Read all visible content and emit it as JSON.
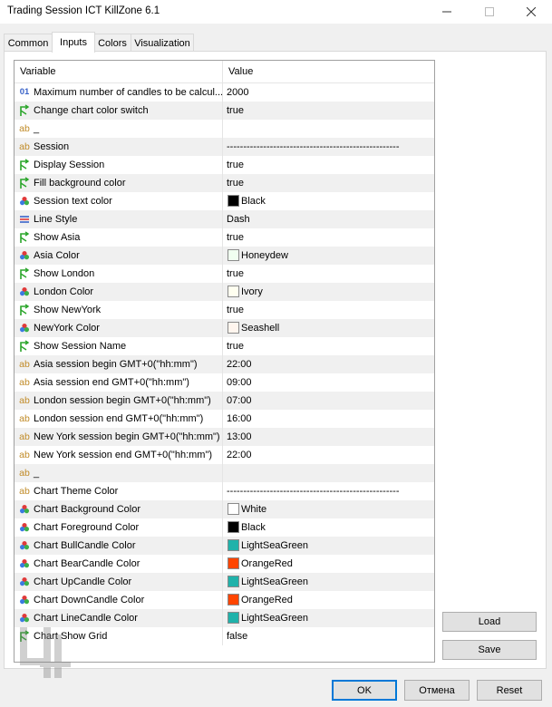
{
  "window": {
    "title": "Trading Session ICT KillZone 6.1",
    "minimize_icon": "minimize-icon",
    "maximize_icon": "maximize-icon",
    "close_icon": "close-icon"
  },
  "tabs": [
    {
      "label": "Common",
      "active": false
    },
    {
      "label": "Inputs",
      "active": true
    },
    {
      "label": "Colors",
      "active": false
    },
    {
      "label": "Visualization",
      "active": false
    }
  ],
  "grid": {
    "headers": {
      "variable": "Variable",
      "value": "Value"
    },
    "rows": [
      {
        "icon": "int",
        "variable": "Maximum number of candles to be calcul...",
        "value": "2000"
      },
      {
        "icon": "bool",
        "variable": "Change chart color switch",
        "value": "true"
      },
      {
        "icon": "string",
        "variable": "_",
        "value": ""
      },
      {
        "icon": "string",
        "variable": "Session",
        "value": "----------------------------------------------------"
      },
      {
        "icon": "bool",
        "variable": "Display Session",
        "value": "true"
      },
      {
        "icon": "bool",
        "variable": "Fill background color",
        "value": "true"
      },
      {
        "icon": "color",
        "variable": "Session text color",
        "value": "Black",
        "swatch": "#000000"
      },
      {
        "icon": "linestyle",
        "variable": "Line Style",
        "value": "Dash"
      },
      {
        "icon": "bool",
        "variable": "Show Asia",
        "value": "true"
      },
      {
        "icon": "color",
        "variable": "Asia Color",
        "value": "Honeydew",
        "swatch": "#f0fff0"
      },
      {
        "icon": "bool",
        "variable": "Show London",
        "value": "true"
      },
      {
        "icon": "color",
        "variable": "London Color",
        "value": "Ivory",
        "swatch": "#fffff0"
      },
      {
        "icon": "bool",
        "variable": "Show NewYork",
        "value": "true"
      },
      {
        "icon": "color",
        "variable": "NewYork Color",
        "value": "Seashell",
        "swatch": "#fff5ee"
      },
      {
        "icon": "bool",
        "variable": "Show Session Name",
        "value": "true"
      },
      {
        "icon": "string",
        "variable": "Asia session begin GMT+0(\"hh:mm\")",
        "value": "22:00"
      },
      {
        "icon": "string",
        "variable": "Asia session end GMT+0(\"hh:mm\")",
        "value": "09:00"
      },
      {
        "icon": "string",
        "variable": "London session begin GMT+0(\"hh:mm\")",
        "value": "07:00"
      },
      {
        "icon": "string",
        "variable": "London session end GMT+0(\"hh:mm\")",
        "value": "16:00"
      },
      {
        "icon": "string",
        "variable": "New York session begin GMT+0(\"hh:mm\")",
        "value": "13:00"
      },
      {
        "icon": "string",
        "variable": "New York session end GMT+0(\"hh:mm\")",
        "value": "22:00"
      },
      {
        "icon": "string",
        "variable": "_",
        "value": ""
      },
      {
        "icon": "string",
        "variable": "Chart Theme Color",
        "value": "----------------------------------------------------"
      },
      {
        "icon": "color",
        "variable": "Chart Background Color",
        "value": "White",
        "swatch": "#ffffff"
      },
      {
        "icon": "color",
        "variable": "Chart Foreground Color",
        "value": "Black",
        "swatch": "#000000"
      },
      {
        "icon": "color",
        "variable": "Chart BullCandle Color",
        "value": "LightSeaGreen",
        "swatch": "#20b2aa"
      },
      {
        "icon": "color",
        "variable": "Chart BearCandle Color",
        "value": "OrangeRed",
        "swatch": "#ff4500"
      },
      {
        "icon": "color",
        "variable": "Chart UpCandle Color",
        "value": "LightSeaGreen",
        "swatch": "#20b2aa"
      },
      {
        "icon": "color",
        "variable": "Chart DownCandle Color",
        "value": "OrangeRed",
        "swatch": "#ff4500"
      },
      {
        "icon": "color",
        "variable": "Chart LineCandle Color",
        "value": "LightSeaGreen",
        "swatch": "#20b2aa"
      },
      {
        "icon": "bool",
        "variable": "Chart Show Grid",
        "value": "false"
      }
    ]
  },
  "side_buttons": {
    "load": "Load",
    "save": "Save"
  },
  "footer_buttons": {
    "ok": "OK",
    "cancel": "Отмена",
    "reset": "Reset"
  },
  "colors": {
    "accent": "#0078d7",
    "alt_row": "#f0f0f0",
    "bool_icon": "#2aa52a",
    "string_icon": "#c08a26",
    "int_icon": "#3a63c8"
  }
}
